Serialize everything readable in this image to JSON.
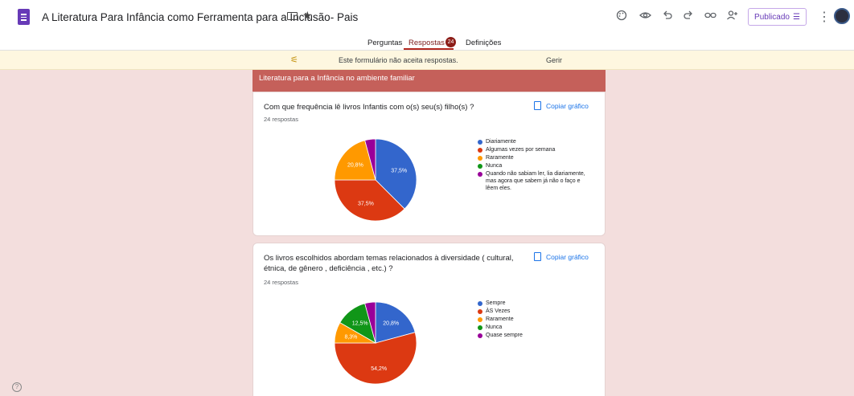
{
  "header": {
    "title": "A Literatura Para  Infância como Ferramenta para a Inclusão- Pais",
    "publish_label": "Publicado",
    "icons": [
      "palette-icon",
      "preview-icon",
      "undo-icon",
      "redo-icon",
      "link-icon",
      "add-collaborator-icon",
      "more-icon"
    ]
  },
  "tabs": {
    "questions": "Perguntas",
    "responses": "Respostas",
    "responses_count": "24",
    "settings": "Definições"
  },
  "notice": {
    "text": "Este formulário não aceita respostas.",
    "manage": "Gerir"
  },
  "section": {
    "title": "Literatura para a Infância no ambiente familiar"
  },
  "copy_label": "Copiar gráfico",
  "chart_data": [
    {
      "type": "pie",
      "title": "Com que frequência lê livros Infantis com o(s) seu(s) filho(s) ?",
      "subtitle": "24 respostas",
      "series": [
        {
          "name": "Diariamente",
          "value": 37.5,
          "color": "#3366cc",
          "label": "37,5%"
        },
        {
          "name": "Algumas vezes por semana",
          "value": 37.5,
          "color": "#dc3912",
          "label": "37,5%"
        },
        {
          "name": "Raramente",
          "value": 20.8,
          "color": "#ff9900",
          "label": "20,8%"
        },
        {
          "name": "Nunca",
          "value": 0,
          "color": "#109618",
          "label": ""
        },
        {
          "name": "Quando não sabiam ler, lia diariamente, mas agora que sabem já não o faço e lêem eles.",
          "value": 4.2,
          "color": "#990099",
          "label": ""
        }
      ]
    },
    {
      "type": "pie",
      "title": "Os livros escolhidos abordam temas relacionados à diversidade ( cultural, étnica, de gênero , deficiência , etc.) ?",
      "subtitle": "24 respostas",
      "series": [
        {
          "name": "Sempre",
          "value": 20.8,
          "color": "#3366cc",
          "label": "20,8%"
        },
        {
          "name": "ÀS Vezes",
          "value": 54.2,
          "color": "#dc3912",
          "label": "54,2%"
        },
        {
          "name": "Raramente",
          "value": 8.3,
          "color": "#ff9900",
          "label": "8,3%"
        },
        {
          "name": "Nunca",
          "value": 12.5,
          "color": "#109618",
          "label": "12,5%"
        },
        {
          "name": "Quase sempre",
          "value": 4.2,
          "color": "#990099",
          "label": ""
        }
      ]
    }
  ]
}
